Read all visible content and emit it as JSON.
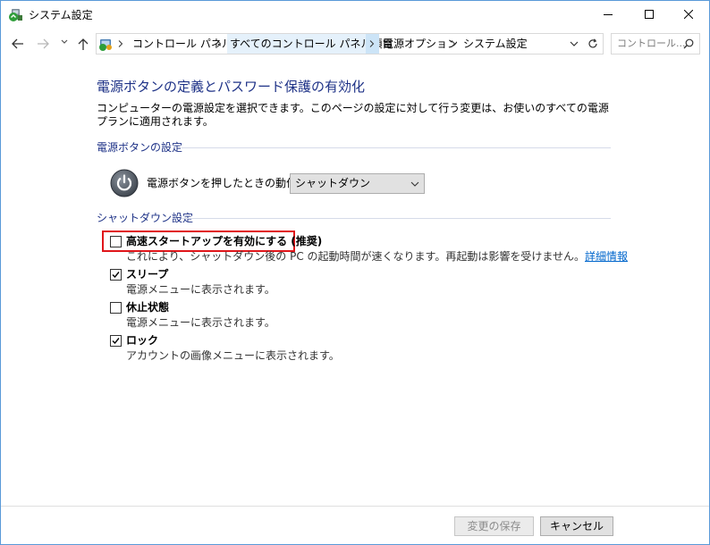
{
  "window": {
    "title": "システム設定",
    "icon": "power-options-icon",
    "controls": [
      "minimize-icon",
      "maximize-icon",
      "close-icon"
    ]
  },
  "nav": {
    "back": "back-arrow-icon",
    "forward": "forward-arrow-icon",
    "recent": "recent-locations-icon",
    "up": "up-arrow-icon"
  },
  "breadcrumb": {
    "items": [
      "コントロール パネル",
      "すべてのコントロール パネル項目",
      "電源オプション",
      "システム設定"
    ]
  },
  "search": {
    "placeholder": "コントロール..."
  },
  "page": {
    "heading": "電源ボタンの定義とパスワード保護の有効化",
    "description": "コンピューターの電源設定を選択できます。このページの設定に対して行う変更は、お使いのすべての電源プランに適用されます。"
  },
  "power_button_section": {
    "title": "電源ボタンの設定",
    "action_label": "電源ボタンを押したときの動作:",
    "action_value": "シャットダウン"
  },
  "shutdown_section": {
    "title": "シャットダウン設定",
    "options": [
      {
        "label": "高速スタートアップを有効にする (推奨)",
        "checked": false,
        "highlighted": true,
        "description": "これにより、シャットダウン後の PC の起動時間が速くなります。再起動は影響を受けません。",
        "link": "詳細情報"
      },
      {
        "label": "スリープ",
        "checked": true,
        "description": "電源メニューに表示されます。"
      },
      {
        "label": "休止状態",
        "checked": false,
        "description": "電源メニューに表示されます。"
      },
      {
        "label": "ロック",
        "checked": true,
        "description": "アカウントの画像メニューに表示されます。"
      }
    ]
  },
  "footer": {
    "save_label": "変更の保存",
    "save_enabled": false,
    "cancel_label": "キャンセル"
  },
  "colors": {
    "heading": "#1e3287",
    "link": "#0066cc",
    "highlight": "#e0161b",
    "window_border": "#5a9ad8"
  }
}
